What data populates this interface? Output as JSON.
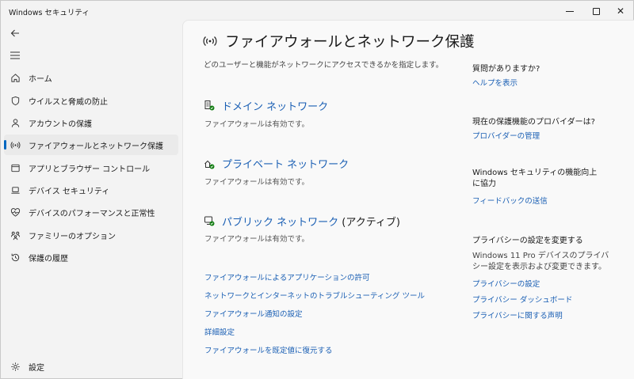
{
  "window": {
    "title": "Windows セキュリティ",
    "buttons": {
      "minimize": "minimize",
      "maximize": "maximize",
      "close": "✕"
    }
  },
  "sidebar": {
    "items": [
      {
        "label": "ホーム",
        "icon": "home-icon"
      },
      {
        "label": "ウイルスと脅威の防止",
        "icon": "shield-icon"
      },
      {
        "label": "アカウントの保護",
        "icon": "person-icon"
      },
      {
        "label": "ファイアウォールとネットワーク保護",
        "icon": "signal-icon",
        "active": true
      },
      {
        "label": "アプリとブラウザー コントロール",
        "icon": "app-window-icon"
      },
      {
        "label": "デバイス セキュリティ",
        "icon": "laptop-icon"
      },
      {
        "label": "デバイスのパフォーマンスと正常性",
        "icon": "heart-icon"
      },
      {
        "label": "ファミリーのオプション",
        "icon": "family-icon"
      },
      {
        "label": "保護の履歴",
        "icon": "history-icon"
      }
    ],
    "settings": {
      "label": "設定",
      "icon": "gear-icon"
    }
  },
  "main": {
    "title": "ファイアウォールとネットワーク保護",
    "subtitle": "どのユーザーと機能がネットワークにアクセスできるかを指定します。",
    "networks": [
      {
        "name": "ドメイン ネットワーク",
        "suffix": "",
        "status": "ファイアウォールは有効です。",
        "icon": "domain-network-icon"
      },
      {
        "name": "プライベート ネットワーク",
        "suffix": "",
        "status": "ファイアウォールは有効です。",
        "icon": "private-network-icon"
      },
      {
        "name": "パブリック ネットワーク",
        "suffix": " (アクティブ)",
        "status": "ファイアウォールは有効です。",
        "icon": "public-network-icon"
      }
    ],
    "links": [
      "ファイアウォールによるアプリケーションの許可",
      "ネットワークとインターネットのトラブルシューティング ツール",
      "ファイアウォール通知の設定",
      "詳細設定",
      "ファイアウォールを既定値に復元する"
    ]
  },
  "aside": {
    "help_heading": "質問がありますか?",
    "help_link": "ヘルプを表示",
    "provider_heading": "現在の保護機能のプロバイダーは?",
    "provider_link": "プロバイダーの管理",
    "improve_heading": "Windows セキュリティの機能向上に協力",
    "feedback_link": "フィードバックの送信",
    "privacy_heading": "プライバシーの設定を変更する",
    "privacy_text": "Windows 11 Pro デバイスのプライバシー設定を表示および変更できます。",
    "privacy_links": [
      "プライバシーの設定",
      "プライバシー ダッシュボード",
      "プライバシーに関する声明"
    ]
  },
  "colors": {
    "link": "#1a5fb4",
    "accent": "#0067c0",
    "active_bg": "#eaeaea"
  }
}
